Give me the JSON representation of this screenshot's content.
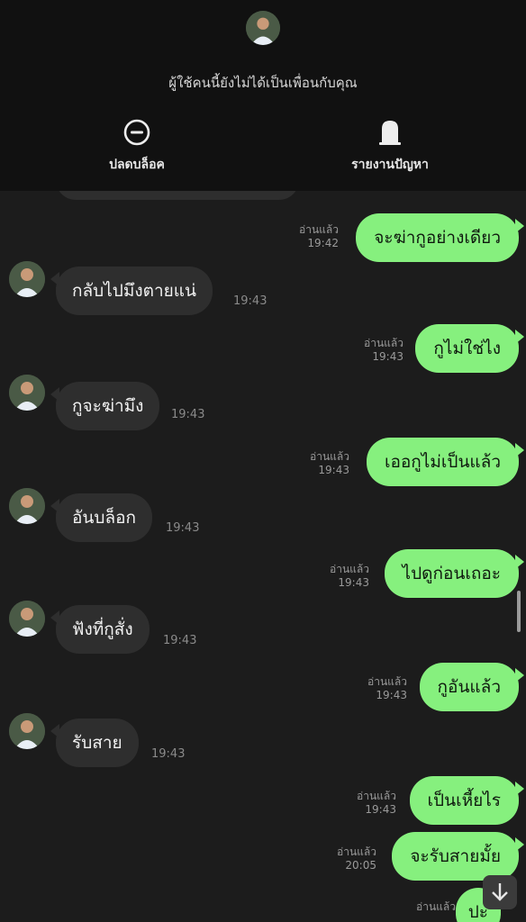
{
  "header": {
    "notice": "ผู้ใช้คนนี้ยังไม่ได้เป็นเพื่อนกับคุณ",
    "unblock_label": "ปลดบล็อค",
    "report_label": "รายงานปัญหา"
  },
  "messages": [
    {
      "side": "out",
      "text": "จะฆ่ากูอย่างเดียว",
      "read": "อ่านแล้ว",
      "time": "19:42"
    },
    {
      "side": "in",
      "text": "กลับไปมึงตายแน่",
      "time": "19:43"
    },
    {
      "side": "out",
      "text": "กูไม่ใช่ไง",
      "read": "อ่านแล้ว",
      "time": "19:43"
    },
    {
      "side": "in",
      "text": "กูจะฆ่ามึง",
      "time": "19:43"
    },
    {
      "side": "out",
      "text": "เออกูไม่เป็นแล้ว",
      "read": "อ่านแล้ว",
      "time": "19:43"
    },
    {
      "side": "in",
      "text": "อันบล็อก",
      "time": "19:43"
    },
    {
      "side": "out",
      "text": "ไปดูก่อนเถอะ",
      "read": "อ่านแล้ว",
      "time": "19:43"
    },
    {
      "side": "in",
      "text": "ฟังที่กูสั่ง",
      "time": "19:43"
    },
    {
      "side": "out",
      "text": "กูอันแล้ว",
      "read": "อ่านแล้ว",
      "time": "19:43"
    },
    {
      "side": "in",
      "text": "รับสาย",
      "time": "19:43"
    },
    {
      "side": "out",
      "text": "เป็นเหี้ยไร",
      "read": "อ่านแล้ว",
      "time": "19:43"
    },
    {
      "side": "out",
      "text": "จะรับสายมั้ย",
      "read": "อ่านแล้ว",
      "time": "20:05"
    },
    {
      "side": "out",
      "text": "ปะ",
      "read": "อ่านแล้ว",
      "time": ""
    }
  ],
  "icons": {
    "unblock": "minus-circle-icon",
    "report": "tombstone-icon",
    "scroll_down": "arrow-down-icon"
  },
  "colors": {
    "outgoing_bubble": "#86f07e",
    "incoming_bubble": "#2e2e2e",
    "background": "#1c1c1c",
    "header": "#111111"
  }
}
